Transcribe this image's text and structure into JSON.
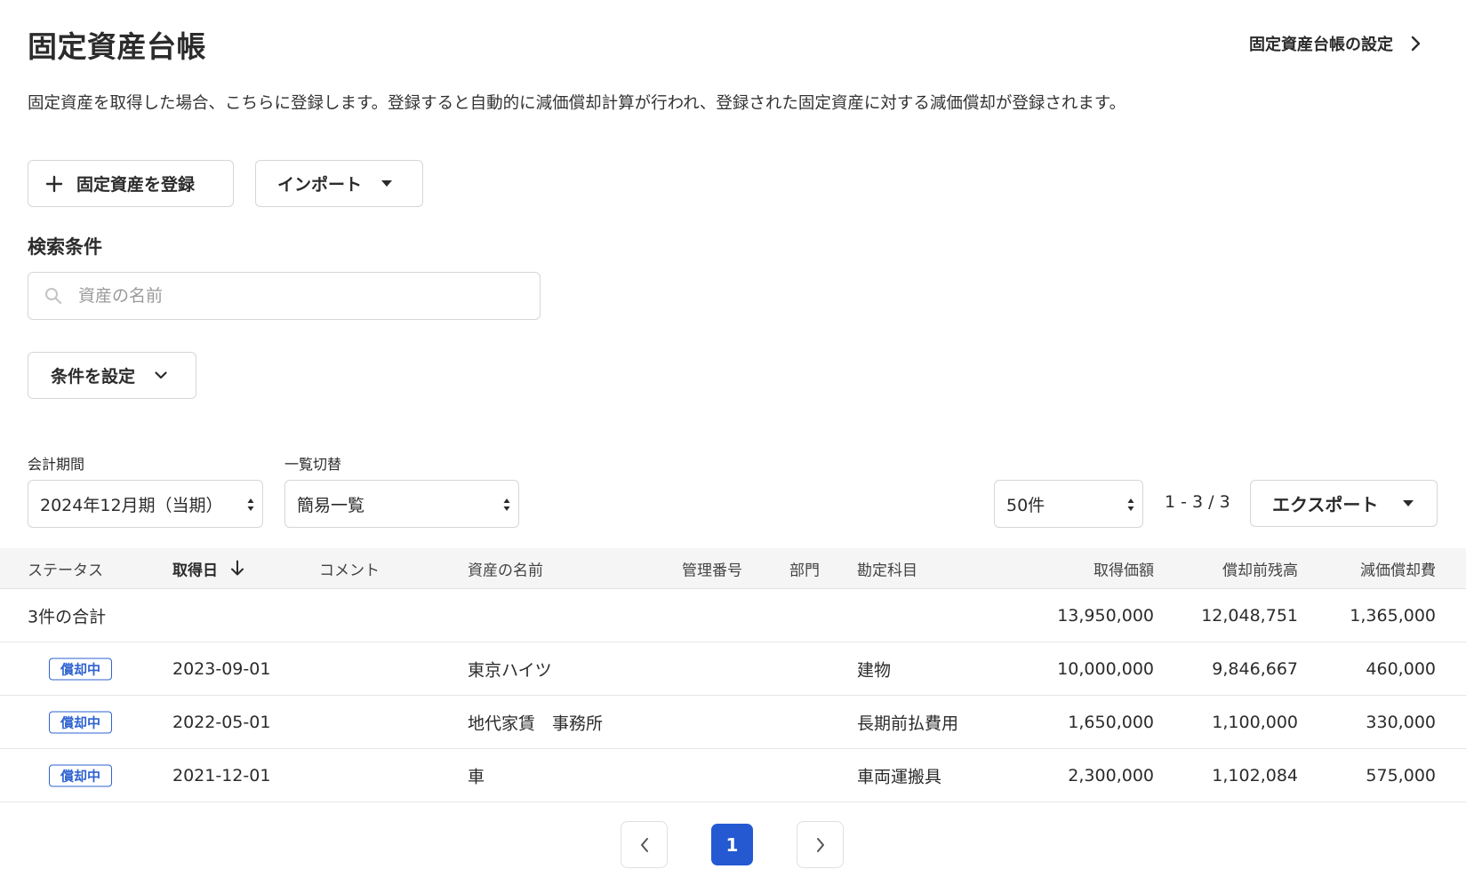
{
  "header": {
    "title": "固定資産台帳",
    "settings_link": "固定資産台帳の設定",
    "description": "固定資産を取得した場合、こちらに登録します。登録すると自動的に減価償却計算が行われ、登録された固定資産に対する減価償却が登録されます。"
  },
  "actions": {
    "register_label": "固定資産を登録",
    "import_label": "インポート"
  },
  "search": {
    "heading": "検索条件",
    "placeholder": "資産の名前",
    "condition_label": "条件を設定"
  },
  "filters": {
    "period_label": "会計期間",
    "period_value": "2024年12月期（当期）",
    "view_label": "一覧切替",
    "view_value": "簡易一覧",
    "per_page_value": "50件",
    "range_text": "1 - 3 / 3",
    "export_label": "エクスポート"
  },
  "table": {
    "columns": {
      "status": "ステータス",
      "acquired_date": "取得日",
      "comment": "コメント",
      "asset_name": "資産の名前",
      "management_no": "管理番号",
      "department": "部門",
      "account": "勘定科目",
      "acquisition_cost": "取得価額",
      "pre_depreciation_balance": "償却前残高",
      "depreciation_expense": "減価償却費"
    },
    "summary": {
      "label": "3件の合計",
      "acquisition_cost": "13,950,000",
      "pre_depreciation_balance": "12,048,751",
      "depreciation_expense": "1,365,000"
    },
    "rows": [
      {
        "status": "償却中",
        "acquired_date": "2023-09-01",
        "asset_name": "東京ハイツ",
        "account": "建物",
        "acquisition_cost": "10,000,000",
        "pre_depreciation_balance": "9,846,667",
        "depreciation_expense": "460,000"
      },
      {
        "status": "償却中",
        "acquired_date": "2022-05-01",
        "asset_name": "地代家賃　事務所",
        "account": "長期前払費用",
        "acquisition_cost": "1,650,000",
        "pre_depreciation_balance": "1,100,000",
        "depreciation_expense": "330,000"
      },
      {
        "status": "償却中",
        "acquired_date": "2021-12-01",
        "asset_name": "車",
        "account": "車両運搬具",
        "acquisition_cost": "2,300,000",
        "pre_depreciation_balance": "1,102,084",
        "depreciation_expense": "575,000"
      }
    ]
  },
  "pagination": {
    "current_page": "1"
  },
  "colors": {
    "accent": "#2459d2",
    "badge": "#2f63d1",
    "header_bg": "#f5f5f5",
    "border": "#d6d6d6"
  }
}
